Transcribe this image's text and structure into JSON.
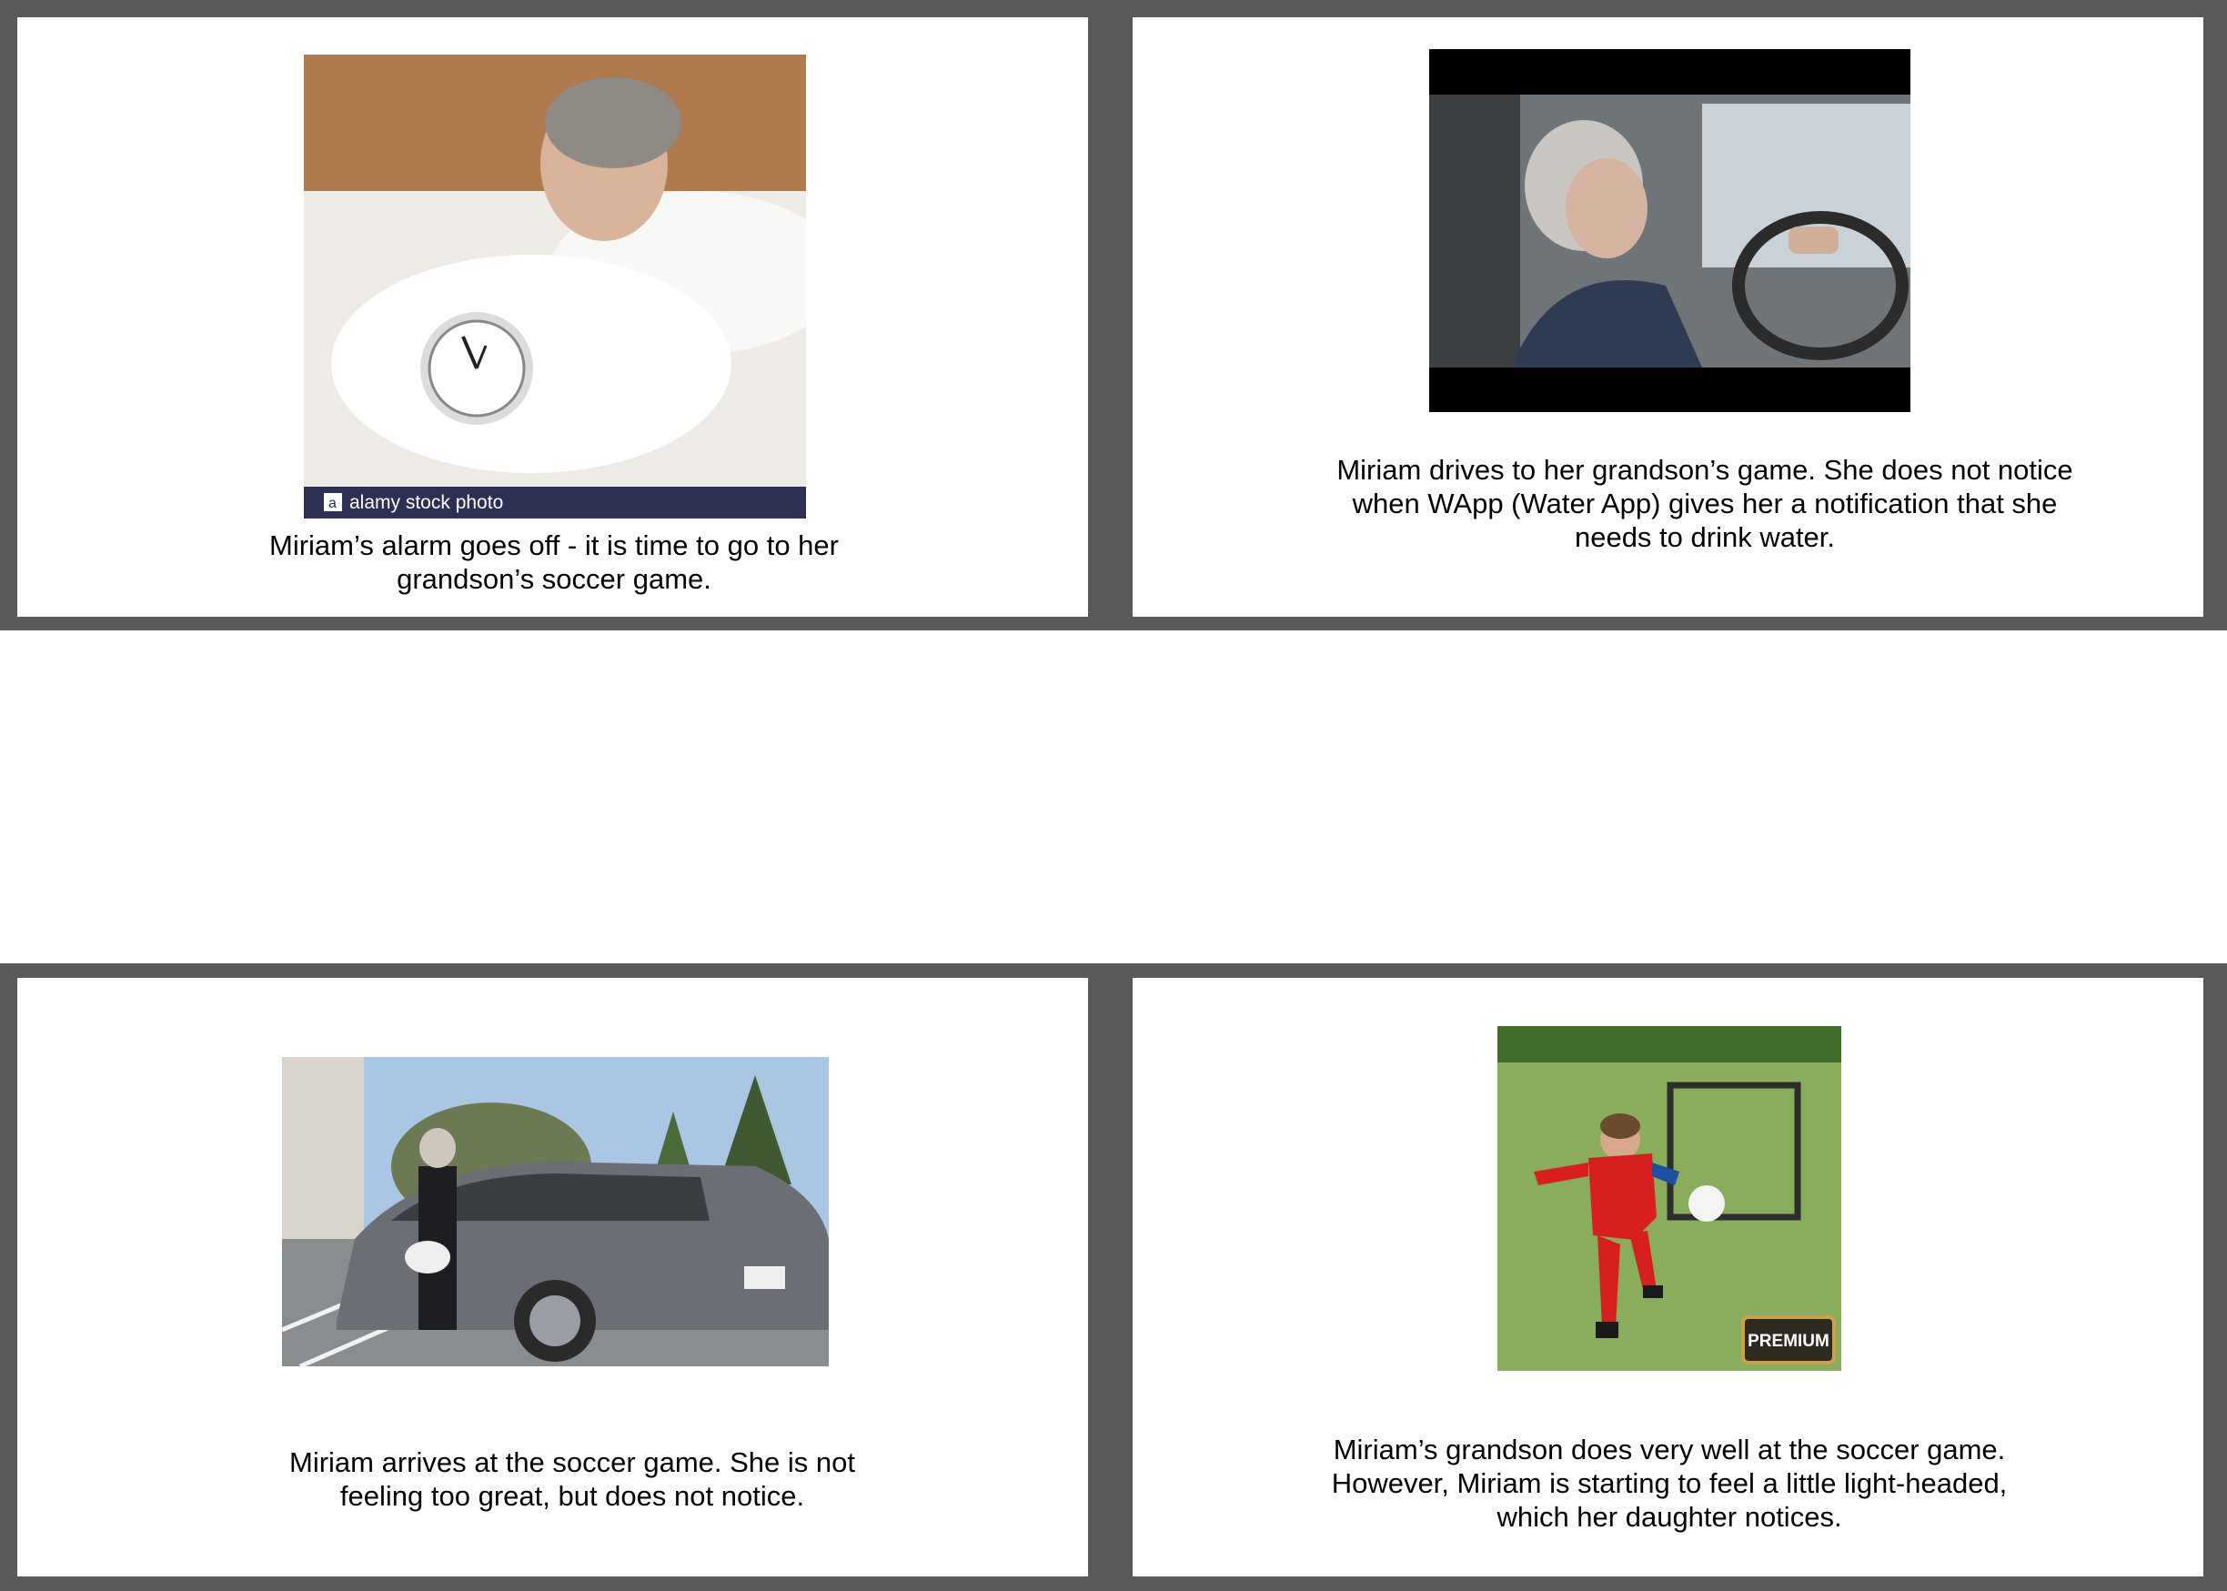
{
  "frame_color": "#595959",
  "panels": [
    {
      "image_name": "woman-in-bed-with-alarm-clock-photo",
      "image_watermark": "alamy stock photo",
      "caption": "Miriam’s alarm goes off - it is time to go to her grandson’s soccer game."
    },
    {
      "image_name": "woman-driving-car-photo",
      "caption": "Miriam drives to her grandson’s game. She does not notice when WApp (Water App) gives her a notification that she needs to drink water."
    },
    {
      "image_name": "woman-getting-out-of-car-photo",
      "caption": "Miriam arrives at the soccer game. She is not feeling too great, but does not notice."
    },
    {
      "image_name": "boy-kicking-soccer-ball-photo",
      "image_badge": "PREMIUM",
      "caption": "Miriam’s grandson does very well at the soccer game. However, Miriam is starting to feel a little light-headed, which her daughter notices."
    }
  ]
}
